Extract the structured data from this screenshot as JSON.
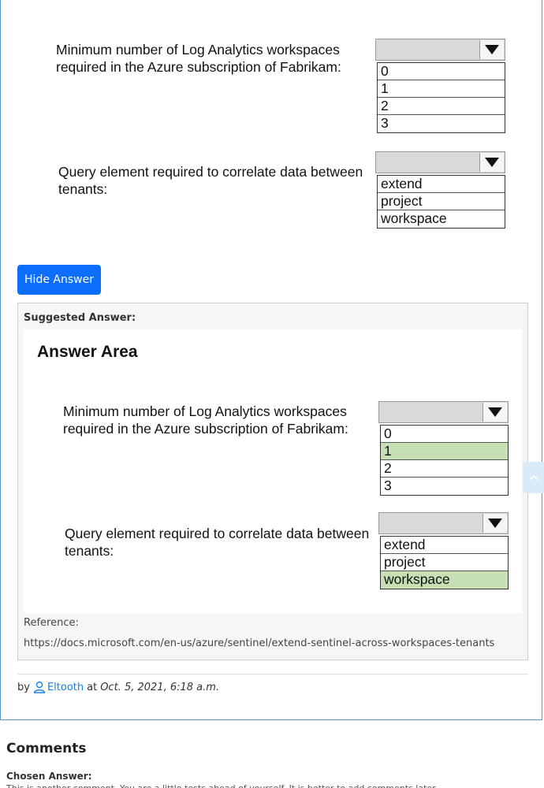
{
  "question": {
    "q1": {
      "text": "Minimum number of Log Analytics workspaces\nrequired in the Azure subscription of Fabrikam:",
      "options": [
        "0",
        "1",
        "2",
        "3"
      ]
    },
    "q2": {
      "text": "Query element required to correlate data between\ntenants:",
      "options": [
        "extend",
        "project",
        "workspace"
      ]
    }
  },
  "hide_answer_label": "Hide Answer",
  "suggested": {
    "label": "Suggested Answer:",
    "answer_area_title": "Answer Area",
    "q1": {
      "text": "Minimum number of Log Analytics workspaces\nrequired in the Azure subscription of Fabrikam:",
      "options": [
        "0",
        "1",
        "2",
        "3"
      ],
      "selected": "1"
    },
    "q2": {
      "text": "Query element required to correlate data between\ntenants:",
      "options": [
        "extend",
        "project",
        "workspace"
      ],
      "selected": "workspace"
    },
    "reference_label": "Reference:",
    "reference_url": "https://docs.microsoft.com/en-us/azure/sentinel/extend-sentinel-across-workspaces-tenants"
  },
  "byline": {
    "by": "by",
    "author": "Eltooth",
    "at": "at",
    "date": "Oct. 5, 2021, 6:18 a.m."
  },
  "comments": {
    "title": "Comments",
    "chosen_label": "Chosen Answer:",
    "snippet": "This is another comment. You are a little tests ahead of yourself. It is better to add comments later..."
  },
  "colors": {
    "accent": "#0d6efd",
    "link": "#1a82e2",
    "selected_option": "#c6e0b4",
    "card_border": "#5a95c8"
  },
  "icons": {
    "dropdown": "triangle-down-icon",
    "user": "user-icon",
    "scroll_top": "chevron-up-icon"
  }
}
